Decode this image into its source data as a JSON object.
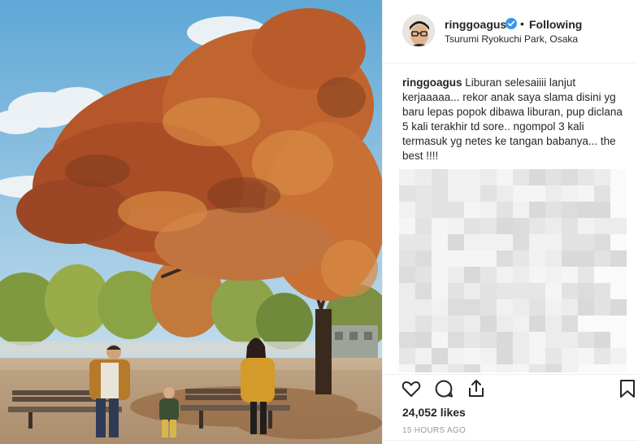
{
  "post": {
    "username": "ringgoagus",
    "bullet": "•",
    "follow_label": "Following",
    "location": "Tsurumi Ryokuchi Park, Osaka"
  },
  "caption": {
    "username": "ringgoagus",
    "text": "Liburan selesaiiii lanjut kerjaaaaa... rekor anak saya slama disini yg baru lepas popok dibawa liburan, pup diclana 5 kali terakhir td sore.. ngompol 3 kali termasuk yg netes ke tangan babanya... the best !!!!"
  },
  "stats": {
    "likes": "24,052 likes",
    "time": "15 HOURS AGO"
  },
  "icons": {
    "like": "heart-icon",
    "comment": "comment-icon",
    "share": "share-icon",
    "save": "bookmark-icon",
    "verified": "verified-badge-icon"
  },
  "colors": {
    "verified": "#3897f0",
    "text": "#262626",
    "muted": "#999999",
    "border": "#efefef"
  }
}
